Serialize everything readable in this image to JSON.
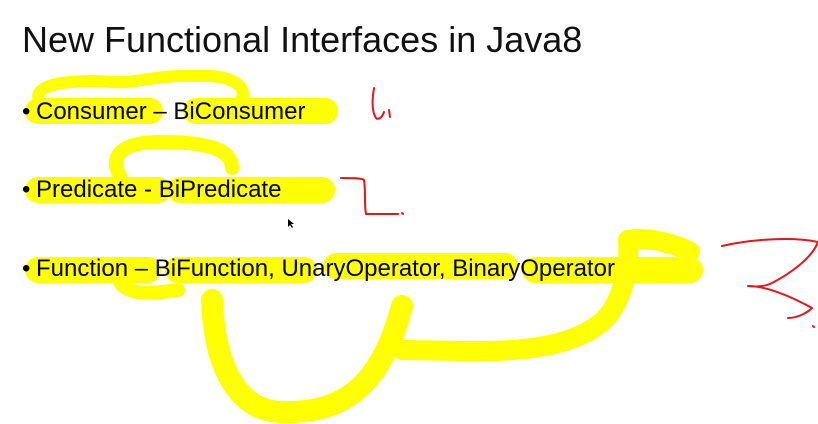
{
  "slide": {
    "title": "New Functional Interfaces in Java8",
    "bullet_glyph": "•",
    "bullets": [
      {
        "text": "Consumer – BiConsumer"
      },
      {
        "text": "Predicate - BiPredicate"
      },
      {
        "text": "Function – BiFunction, UnaryOperator, BinaryOperator"
      }
    ]
  },
  "annotations": {
    "highlight_color": "#ffff00",
    "pen_color": "#e8141b"
  }
}
